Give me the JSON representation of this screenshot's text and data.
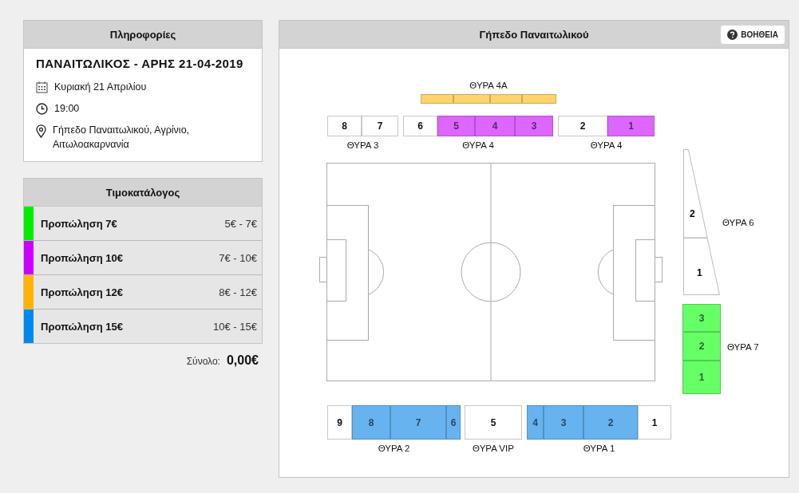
{
  "info": {
    "title": "Πληροφορίες",
    "match": "ΠΑΝΑΙΤΩΛΙΚΟΣ - ΑΡΗΣ 21-04-2019",
    "date": "Κυριακή 21 Απριλίου",
    "time": "19:00",
    "venue": "Γήπεδο Παναιτωλικού, Αγρίνιο, Αιτωλοακαρνανία"
  },
  "pricelist": {
    "title": "Τιμοκατάλογος",
    "items": [
      {
        "name": "Προπώληση 7€",
        "range": "5€ - 7€",
        "color": "#00ee00"
      },
      {
        "name": "Προπώληση 10€",
        "range": "7€ - 10€",
        "color": "#cc00ff"
      },
      {
        "name": "Προπώληση 12€",
        "range": "8€ - 12€",
        "color": "#ffb300"
      },
      {
        "name": "Προπώληση 15€",
        "range": "10€ - 15€",
        "color": "#0088ee"
      }
    ]
  },
  "total": {
    "label": "Σύνολο:",
    "value": "0,00€"
  },
  "stadium": {
    "title": "Γήπεδο Παναιτωλικού",
    "help": "ΒΟΗΘΕΙΑ",
    "gates": [
      {
        "kind": "row",
        "label": "ΘΥΡΑ 4Α",
        "blocks": [
          {
            "color": "#ffd36b"
          },
          {
            "color": "#ffd36b"
          },
          {
            "color": "#ffd36b"
          },
          {
            "color": "#ffd36b"
          }
        ]
      },
      {
        "kind": "row",
        "label": "ΘΥΡΑ 3",
        "blocks": [
          {
            "label": "8"
          },
          {
            "label": "7"
          }
        ]
      },
      {
        "kind": "row",
        "label": "ΘΥΡΑ 4",
        "blocks": [
          {
            "label": "6"
          },
          {
            "label": "5",
            "color": "#dd66ff"
          },
          {
            "label": "4",
            "color": "#dd66ff"
          },
          {
            "label": "3",
            "color": "#dd66ff"
          }
        ]
      },
      {
        "kind": "row",
        "label": "ΘΥΡΑ 4",
        "blocks": [
          {
            "label": "2"
          },
          {
            "label": "1",
            "color": "#dd66ff"
          }
        ]
      },
      {
        "kind": "wedge",
        "label": "ΘΥΡΑ 6",
        "blocks": [
          {
            "label": "2"
          },
          {
            "label": "1"
          }
        ]
      },
      {
        "kind": "column",
        "label": "ΘΥΡΑ 7",
        "blocks": [
          {
            "label": "3",
            "color": "#66ff66"
          },
          {
            "label": "2",
            "color": "#66ff66"
          },
          {
            "label": "1",
            "color": "#66ff66"
          }
        ]
      },
      {
        "kind": "row",
        "label": "ΘΥΡΑ 2",
        "blocks": [
          {
            "label": "9"
          },
          {
            "label": "8",
            "color": "#66b3f0"
          },
          {
            "label": "7",
            "color": "#66b3f0"
          },
          {
            "label": "6",
            "color": "#66b3f0"
          }
        ]
      },
      {
        "kind": "row",
        "label": "ΘΥΡΑ VIP",
        "blocks": [
          {
            "label": "5"
          }
        ]
      },
      {
        "kind": "row",
        "label": "ΘΥΡΑ 1",
        "blocks": [
          {
            "label": "4",
            "color": "#66b3f0"
          },
          {
            "label": "3",
            "color": "#66b3f0"
          },
          {
            "label": "2",
            "color": "#66b3f0"
          },
          {
            "label": "1"
          }
        ]
      }
    ]
  }
}
